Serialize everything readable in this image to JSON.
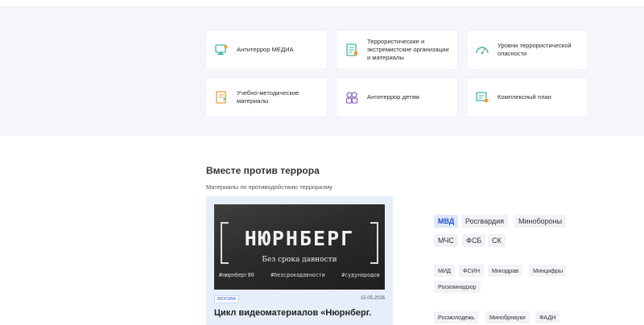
{
  "header": {
    "cut_text": ""
  },
  "categories": [
    {
      "label": "Антитеррор МЕДИА",
      "icon": "monitor-icon"
    },
    {
      "label": "Террористические и экстремистские организации и материалы",
      "icon": "document-list-icon"
    },
    {
      "label": "Уровни террористической опасности",
      "icon": "gauge-icon"
    },
    {
      "label": "Учебно-методические материалы",
      "icon": "notebook-icon"
    },
    {
      "label": "Антитеррор детям",
      "icon": "children-icon"
    },
    {
      "label": "Комплексный план",
      "icon": "plan-icon"
    }
  ],
  "section": {
    "title": "Вместе против террора",
    "subtitle": "Материалы по противодействию терроризму"
  },
  "news": {
    "banner_title": "НЮРНБЕРГ",
    "banner_subtitle": "Без срока давности",
    "hashtags": [
      "#нюрнберг80",
      "#безсрокадавности",
      "#судународов"
    ],
    "location_tag": "МОСКВА",
    "date": "15.05.2026",
    "headline": "Цикл видеоматериалов «Нюрнберг."
  },
  "agencies": {
    "row1": [
      "МВД",
      "Росгвардия",
      "Минобороны"
    ],
    "row2": [
      "МЧС",
      "ФСБ",
      "СК"
    ],
    "row3": [
      "МИД",
      "ФСИН",
      "Минздрав",
      "Минцифры"
    ],
    "row4": [
      "Роскомнадзор"
    ],
    "row5": [
      "Росмолодежь",
      "Минобрнауки",
      "ФАДН"
    ],
    "active": "МВД"
  },
  "colors": {
    "accent": "#2550c8",
    "icon_teal": "#3fb3a6",
    "icon_orange": "#e8a23a",
    "icon_purple": "#8f6cc7",
    "band_bg": "#f4f6fb",
    "news_bg": "#e6eefb"
  }
}
